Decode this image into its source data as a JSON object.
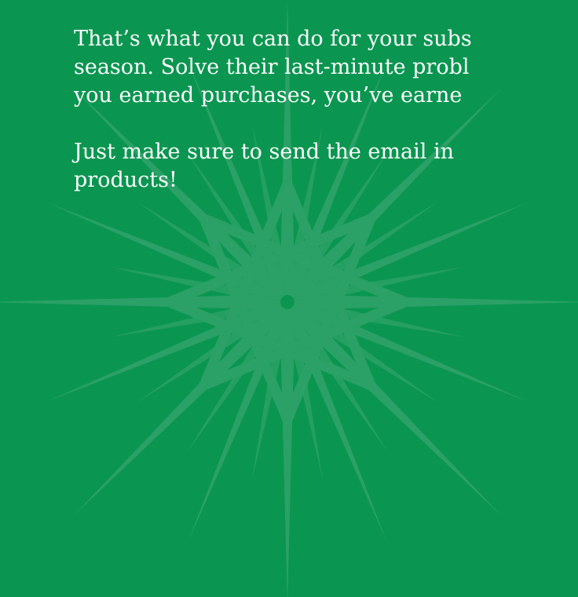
{
  "colors": {
    "background": "#0A9650",
    "star": "#2FA26A",
    "text": "#FFFFFF"
  },
  "decoration": {
    "background_motif": "snowflake-star"
  },
  "content": {
    "paragraph1": [
      "That’s what you can do for your subs",
      "season. Solve their last-minute probl",
      "you earned purchases, you’ve earne"
    ],
    "paragraph2": [
      "Just make sure to send the email in",
      "products!"
    ]
  }
}
